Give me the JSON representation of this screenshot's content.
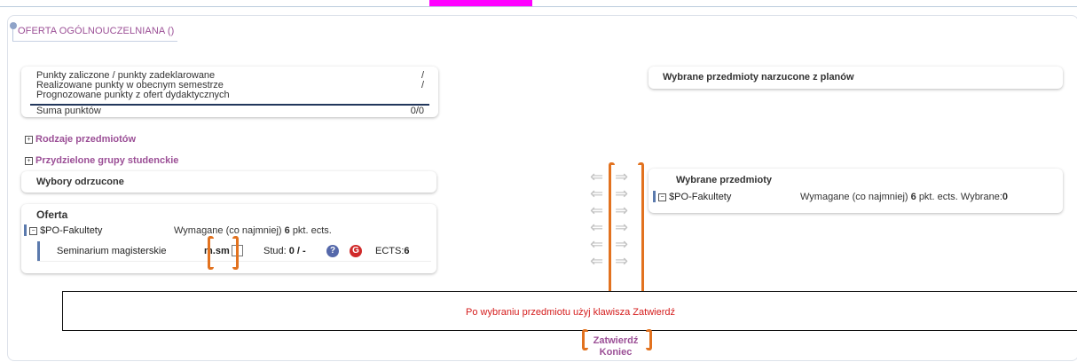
{
  "header": {
    "prefix": "",
    "suffix": ""
  },
  "section_title": "OFERTA OGÓLNOUCZELNIANA ()",
  "points": {
    "rows": [
      {
        "label": "Punkty zaliczone / punkty zadeklarowane",
        "value": "/"
      },
      {
        "label": "Realizowane punkty w obecnym semestrze",
        "value": "/"
      },
      {
        "label": "Prognozowane punkty z ofert dydaktycznych",
        "value": ""
      },
      {
        "label": "Suma punktów",
        "value": "0/0"
      }
    ]
  },
  "tree": {
    "rodzaje": "Rodzaje przedmiotów",
    "grupy": "Przydzielone grupy studenckie",
    "expand_symbol": "⊞",
    "collapse_symbol": "⊟"
  },
  "rejected": {
    "title": "Wybory odrzucone"
  },
  "offer": {
    "title": "Oferta",
    "group_name": "$PO-Fakultety",
    "requirement_prefix": "Wymagane (co najmniej)",
    "requirement_value": "6",
    "requirement_suffix": "pkt. ects.",
    "course": {
      "name": "Seminarium magisterskie",
      "code": "m.sm",
      "stud_label": "Stud:",
      "stud_value": "0 / -",
      "help_icon": "?",
      "g_icon": "G",
      "ects_label": "ECTS:",
      "ects_value": "6",
      "checked": false
    }
  },
  "transfer_arrows": {
    "left": "⇐",
    "right": "⇒",
    "count": 6
  },
  "right": {
    "imposed_title": "Wybrane przedmioty narzucone z planów",
    "selected_title": "Wybrane przedmioty",
    "group_name": "$PO-Fakultety",
    "requirement_prefix": "Wymagane (co najmniej)",
    "requirement_value": "6",
    "requirement_suffix": "pkt. ects.",
    "chosen_label": "Wybrane:",
    "chosen_value": "0"
  },
  "footer_message": "Po wybraniu przedmiotu użyj klawisza Zatwierdź",
  "actions": {
    "confirm": "Zatwierdź",
    "end": "Koniec"
  },
  "colors": {
    "accent_purple": "#9b4f96",
    "highlight_orange": "#e2721f",
    "alert_red": "#d51d1d",
    "navy": "#22375c"
  }
}
